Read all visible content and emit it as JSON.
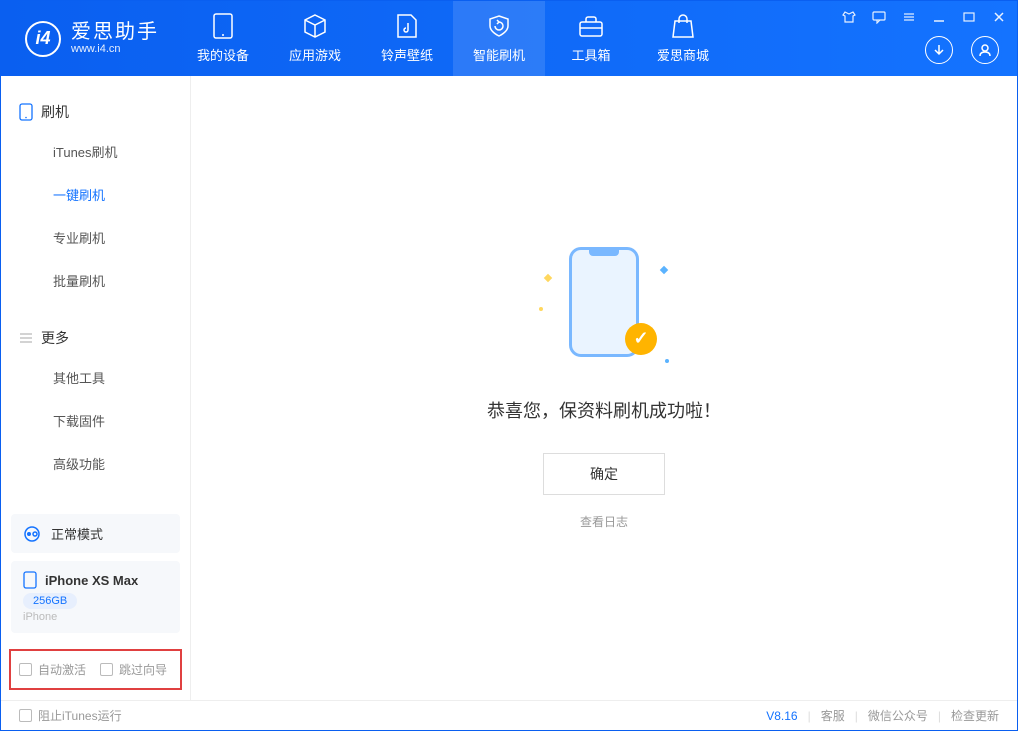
{
  "app": {
    "title": "爱思助手",
    "subtitle": "www.i4.cn"
  },
  "nav": {
    "my_device": "我的设备",
    "apps_games": "应用游戏",
    "ringtones": "铃声壁纸",
    "flash": "智能刷机",
    "toolbox": "工具箱",
    "store": "爱思商城"
  },
  "sidebar": {
    "section_flash": "刷机",
    "items_flash": {
      "itunes": "iTunes刷机",
      "oneclick": "一键刷机",
      "pro": "专业刷机",
      "batch": "批量刷机"
    },
    "section_more": "更多",
    "items_more": {
      "other_tools": "其他工具",
      "download_fw": "下载固件",
      "advanced": "高级功能"
    }
  },
  "device": {
    "mode": "正常模式",
    "name": "iPhone XS Max",
    "capacity": "256GB",
    "type": "iPhone"
  },
  "options": {
    "auto_activate": "自动激活",
    "skip_guide": "跳过向导"
  },
  "main": {
    "success": "恭喜您，保资料刷机成功啦！",
    "ok": "确定",
    "view_log": "查看日志"
  },
  "footer": {
    "block_itunes": "阻止iTunes运行",
    "version": "V8.16",
    "support": "客服",
    "wechat": "微信公众号",
    "check_update": "检查更新"
  }
}
